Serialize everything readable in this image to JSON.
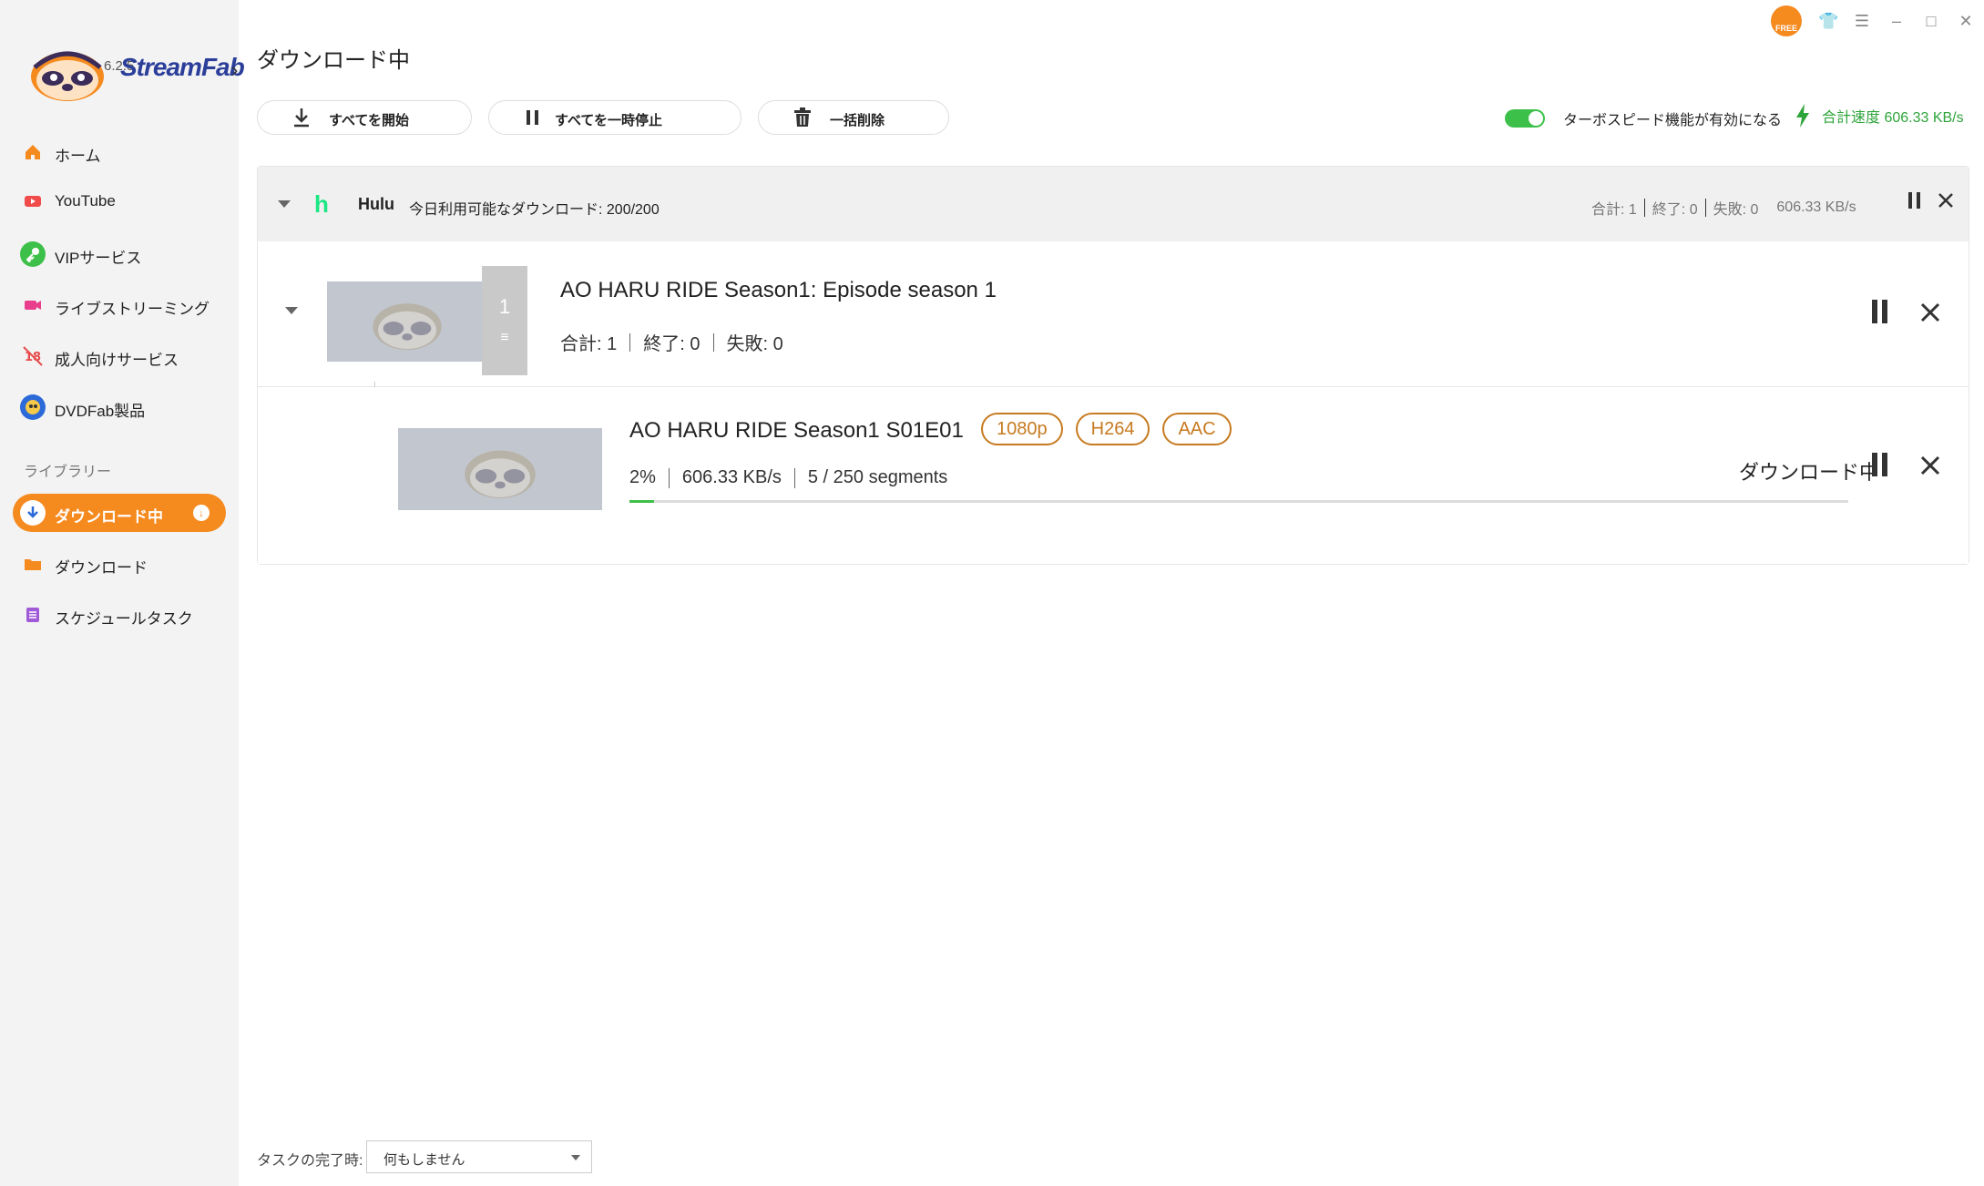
{
  "app": {
    "brand": "StreamFab",
    "version": "6.2.5",
    "free_badge": "FREE"
  },
  "sidebar": {
    "items": [
      {
        "label": "ホーム",
        "icon": "home-icon",
        "color": "#f58a1f"
      },
      {
        "label": "YouTube",
        "icon": "youtube-icon",
        "color": "#f04a4a"
      },
      {
        "label": "VIPサービス",
        "icon": "key-icon",
        "color": "#3dc04a"
      },
      {
        "label": "ライブストリーミング",
        "icon": "camera-icon",
        "color": "#e83e8c"
      },
      {
        "label": "成人向けサービス",
        "icon": "adult-icon",
        "color": "#e84a4a"
      },
      {
        "label": "DVDFab製品",
        "icon": "dvdfab-icon",
        "color": "#2b6ad8"
      }
    ],
    "library_label": "ライブラリー",
    "library": [
      {
        "label": "ダウンロード中",
        "icon": "download-icon",
        "active": true
      },
      {
        "label": "ダウンロード",
        "icon": "folder-icon",
        "color": "#f58a1f"
      },
      {
        "label": "スケジュールタスク",
        "icon": "schedule-icon",
        "color": "#a05ad8"
      }
    ]
  },
  "header": {
    "title": "ダウンロード中"
  },
  "toolbar": {
    "start_all": "すべてを開始",
    "pause_all": "すべてを一時停止",
    "delete_all": "一括削除",
    "turbo_label": "ターボスピード機能が有効になる",
    "turbo_on": true,
    "total_speed": "合計速度 606.33 KB/s"
  },
  "group": {
    "name": "Hulu",
    "quota": "今日利用可能なダウンロード: 200/200",
    "total": "合計: 1",
    "done": "終了: 0",
    "failed": "失敗: 0",
    "speed": "606.33 KB/s"
  },
  "episode": {
    "title": "AO HARU RIDE Season1: Episode season 1",
    "count": "1",
    "total": "合計: 1",
    "done": "終了: 0",
    "failed": "失敗: 0"
  },
  "item": {
    "title": "AO HARU RIDE Season1 S01E01",
    "tags": [
      "1080p",
      "H264",
      "AAC"
    ],
    "percent": "2%",
    "progress": 0.02,
    "speed": "606.33 KB/s",
    "segments": "5 / 250 segments",
    "status": "ダウンロード中"
  },
  "footer": {
    "label": "タスクの完了時:",
    "select_value": "何もしません"
  }
}
